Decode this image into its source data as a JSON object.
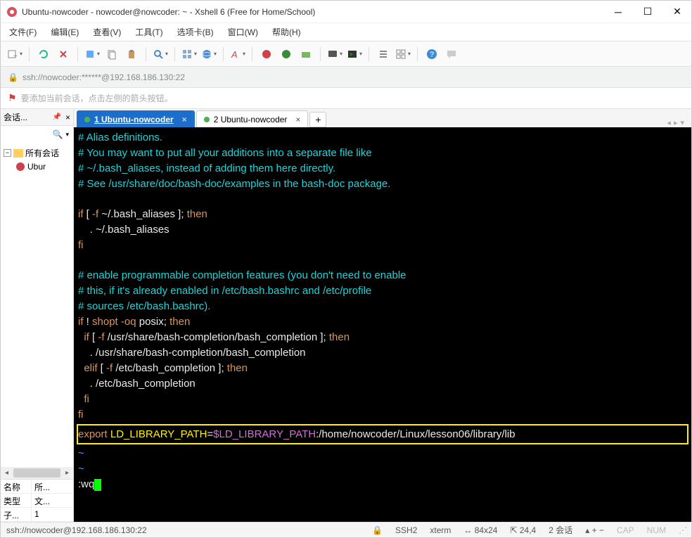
{
  "window": {
    "title": "Ubuntu-nowcoder - nowcoder@nowcoder: ~ - Xshell 6 (Free for Home/School)"
  },
  "menu": {
    "file": "文件(F)",
    "edit": "编辑(E)",
    "view": "查看(V)",
    "tools": "工具(T)",
    "tabs": "选项卡(B)",
    "window": "窗口(W)",
    "help": "帮助(H)"
  },
  "addressbar": {
    "url": "ssh://nowcoder:******@192.168.186.130:22"
  },
  "hintbar": {
    "text": "要添加当前会话，点击左侧的箭头按钮。"
  },
  "sidebar": {
    "header": "会话...",
    "tree": {
      "root": "所有会话",
      "item1": "Ubur"
    },
    "props": {
      "name_k": "名称",
      "name_v": "所...",
      "type_k": "类型",
      "type_v": "文...",
      "child_k": "子...",
      "child_v": "1"
    }
  },
  "tabs": {
    "t1": "1 Ubuntu-nowcoder",
    "t2": "2 Ubuntu-nowcoder"
  },
  "terminal": {
    "l1": "# Alias definitions.",
    "l2": "# You may want to put all your additions into a separate file like",
    "l3": "# ~/.bash_aliases, instead of adding them here directly.",
    "l4": "# See /usr/share/doc/bash-doc/examples in the bash-doc package.",
    "l5_a": "if",
    "l5_b": " [ ",
    "l5_c": "-f",
    "l5_d": " ~/.bash_aliases ]; ",
    "l5_e": "then",
    "l6": "    . ~/.bash_aliases",
    "l7": "fi",
    "l8": "# enable programmable completion features (you don't need to enable",
    "l9": "# this, if it's already enabled in /etc/bash.bashrc and /etc/profile",
    "l10": "# sources /etc/bash.bashrc).",
    "l11_a": "if",
    "l11_b": " ! ",
    "l11_c": "shopt -oq",
    "l11_d": " posix; ",
    "l11_e": "then",
    "l12_a": "  if",
    "l12_b": " [ ",
    "l12_c": "-f",
    "l12_d": " /usr/share/bash-completion/bash_completion ]; ",
    "l12_e": "then",
    "l13": "    . /usr/share/bash-completion/bash_completion",
    "l14_a": "  elif",
    "l14_b": " [ ",
    "l14_c": "-f",
    "l14_d": " /etc/bash_completion ]; ",
    "l14_e": "then",
    "l15": "    . /etc/bash_completion",
    "l16": "  fi",
    "l17": "fi",
    "l18_a": "export",
    "l18_b": " LD_LIBRARY_PATH",
    "l18_c": "=",
    "l18_d": "$LD_LIBRARY_PATH",
    "l18_e": ":/home/nowcoder/Linux/lesson06/library/lib",
    "l19": "~",
    "l20": "~",
    "l21": ":wq"
  },
  "status": {
    "conn": "ssh://nowcoder@192.168.186.130:22",
    "ssh": "SSH2",
    "term": "xterm",
    "size": "84x24",
    "pos": "24,4",
    "sess": "2 会话",
    "cap": "CAP",
    "num": "NUM"
  }
}
